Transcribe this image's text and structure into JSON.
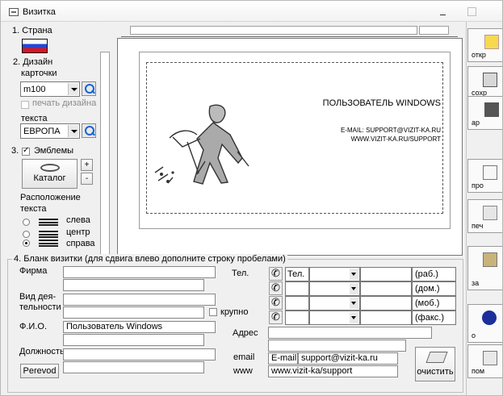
{
  "window": {
    "title": "Визитка"
  },
  "left_panel": {
    "country_label": "1. Страна",
    "design_label": "2. Дизайн",
    "card_label": "карточки",
    "card_design_value": "m100",
    "print_design_label": "печать дизайна",
    "text_label": "текста",
    "text_design_value": "ЕВРОПА",
    "emblems_label": "3.",
    "emblems_check": "Эмблемы",
    "catalog_label": "Каталог",
    "plus": "+",
    "minus": "-",
    "layout_label_1": "Расположение",
    "layout_label_2": "текста",
    "align": [
      "слева",
      "центр",
      "справа"
    ]
  },
  "card": {
    "name": "ПОЛЬЗОВАТЕЛЬ WINDOWS",
    "email": "E-MAIL: SUPPORT@VIZIT-KA.RU",
    "web": "WWW.VIZIT-KA.RU/SUPPORT"
  },
  "toolbar": {
    "open": "откр",
    "save": "сохр",
    "archive": "ар",
    "preview": "про",
    "print": "печ",
    "help": "за",
    "about": "о",
    "other": "пом"
  },
  "form": {
    "legend": "4. Бланк визитки (для сдвига влево дополните строку пробелами)",
    "company_label": "Фирма",
    "activity_label_1": "Вид дея-",
    "activity_label_2": "тельности",
    "large_label": "крупно",
    "fio_label": "Ф.И.О.",
    "fio_value": "Пользователь Windows",
    "position_label": "Должность",
    "perevod_button": "Perevod",
    "tel_label": "Тел.",
    "tel_first": "Тел.",
    "phone_types": [
      "(раб.)",
      "(дом.)",
      "(моб.)",
      "(факс.)"
    ],
    "address_label": "Адрес",
    "email_label": "email",
    "email_prefix": "E-mail:",
    "email_value": "support@vizit-ka.ru",
    "www_label": "www",
    "www_value": "www.vizit-ka/support",
    "clear_button": "очистить"
  },
  "colors": {
    "accent_blue": "#1564d4",
    "flag_blue": "#2347d5",
    "flag_red": "#d91520"
  }
}
